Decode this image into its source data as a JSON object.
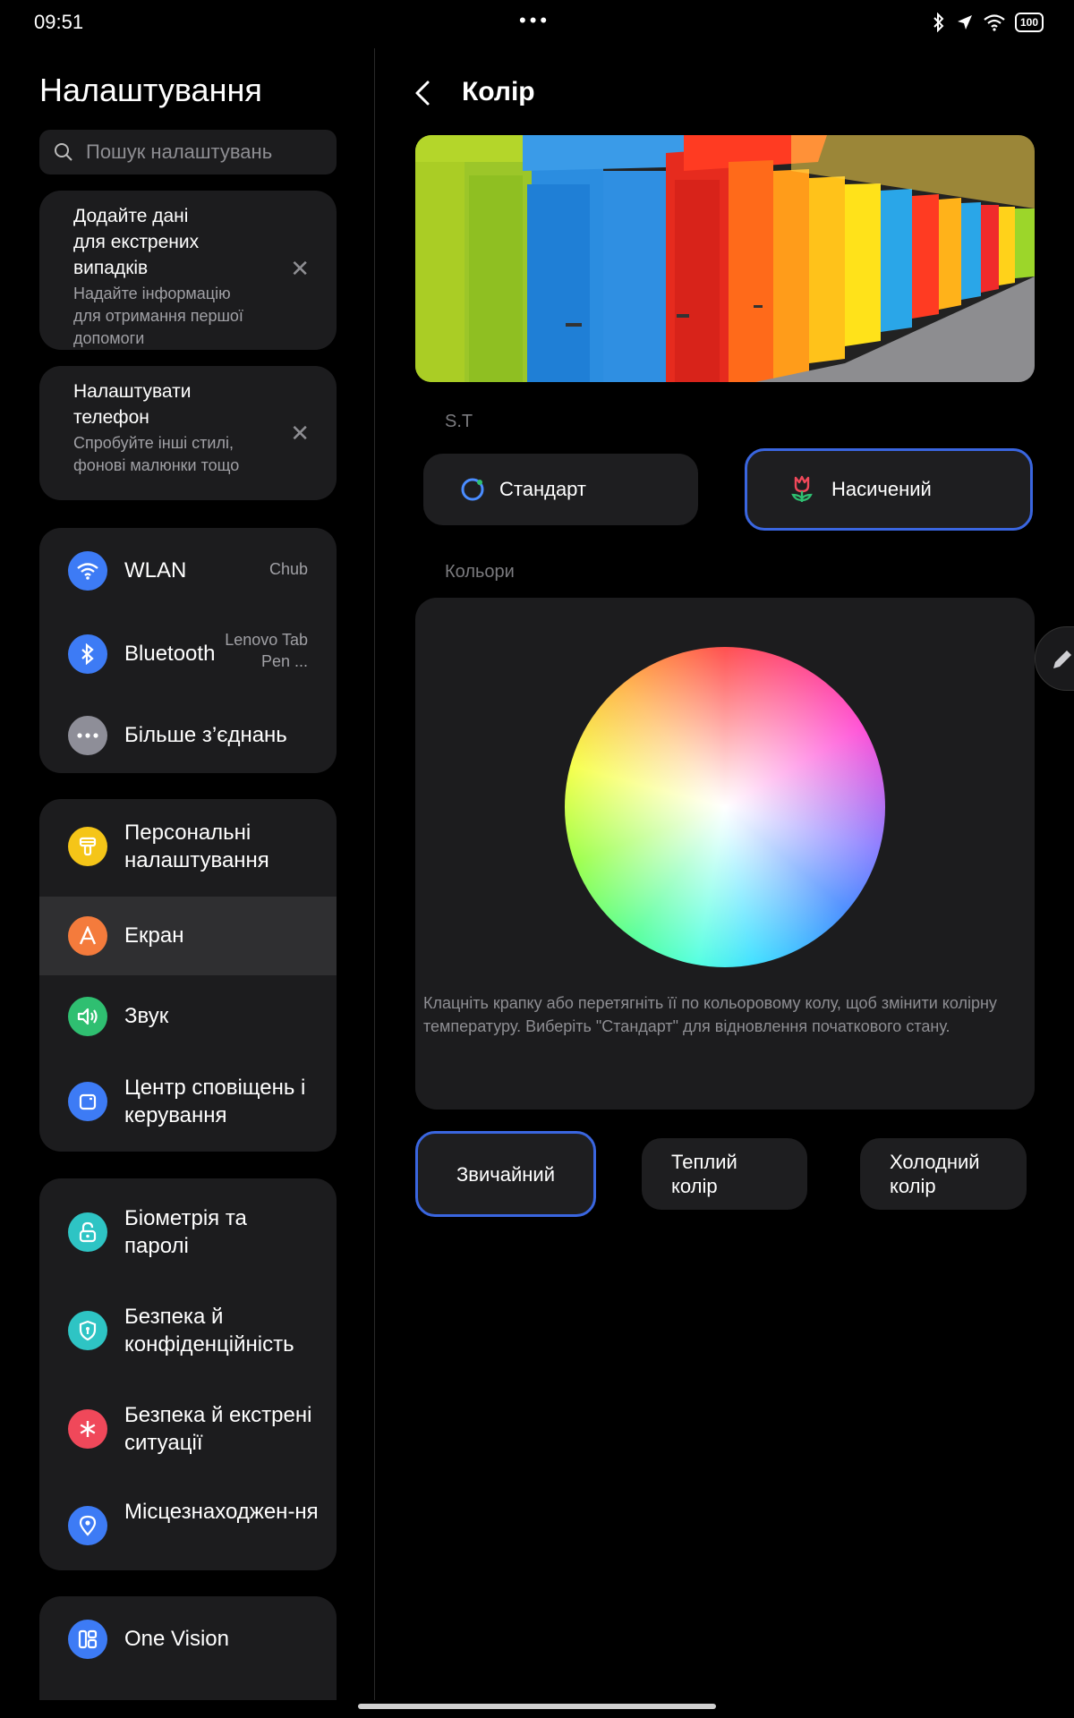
{
  "status_bar": {
    "time": "09:51",
    "battery": "100"
  },
  "left": {
    "title": "Налаштування",
    "search_placeholder": "Пошук налаштувань",
    "suggestions": [
      {
        "title": "Додайте дані для екстрених випадків",
        "subtitle": "Надайте інформацію для отримання першої допомоги"
      },
      {
        "title": "Налаштувати телефон",
        "subtitle": "Спробуйте інші стилі, фонові малюнки тощо"
      }
    ],
    "connections": [
      {
        "label": "WLAN",
        "value": "Chub",
        "icon": "wifi-icon",
        "color": "#3d7bf5"
      },
      {
        "label": "Bluetooth",
        "value": "Lenovo Tab Pen ...",
        "icon": "bluetooth-icon",
        "color": "#3d7bf5"
      },
      {
        "label": "Більше з’єднань",
        "value": "",
        "icon": "more-icon",
        "color": "#8e8e98"
      }
    ],
    "personal": [
      {
        "label": "Персональні налаштування",
        "icon": "brush-icon",
        "color": "#f5c518"
      },
      {
        "label": "Екран",
        "icon": "display-icon",
        "color": "#f47b3c"
      },
      {
        "label": "Звук",
        "icon": "sound-icon",
        "color": "#2fbf71"
      },
      {
        "label": "Центр сповіщень і керування",
        "icon": "notification-icon",
        "color": "#3d7bf5"
      }
    ],
    "security": [
      {
        "label": "Біометрія та паролі",
        "icon": "lock-icon",
        "color": "#2ec4c4"
      },
      {
        "label": "Безпека й конфіденційність",
        "icon": "shield-icon",
        "color": "#2ec4c4"
      },
      {
        "label": "Безпека й екстрені ситуації",
        "icon": "emergency-icon",
        "color": "#f0485a"
      },
      {
        "label": "Місцезнаходжен-ня",
        "icon": "location-icon",
        "color": "#3d7bf5"
      }
    ],
    "other": [
      {
        "label": "One Vision",
        "icon": "one-vision-icon",
        "color": "#3d7bf5"
      }
    ]
  },
  "right": {
    "title": "Колір",
    "mode_section": "S.T",
    "modes": [
      {
        "label": "Стандарт",
        "selected": false
      },
      {
        "label": "Насичений",
        "selected": true
      }
    ],
    "colors_section": "Кольори",
    "hint": "Клацніть крапку або перетягніть її по кольоровому колу, щоб змінити колірну температуру. Виберіть \"Стандарт\" для відновлення початкового стану.",
    "temperatures": [
      {
        "label": "Звичайний",
        "selected": true
      },
      {
        "label": "Теплий колір",
        "selected": false
      },
      {
        "label": "Холодний колір",
        "selected": false
      }
    ],
    "accent_color": "#3a66e0"
  }
}
